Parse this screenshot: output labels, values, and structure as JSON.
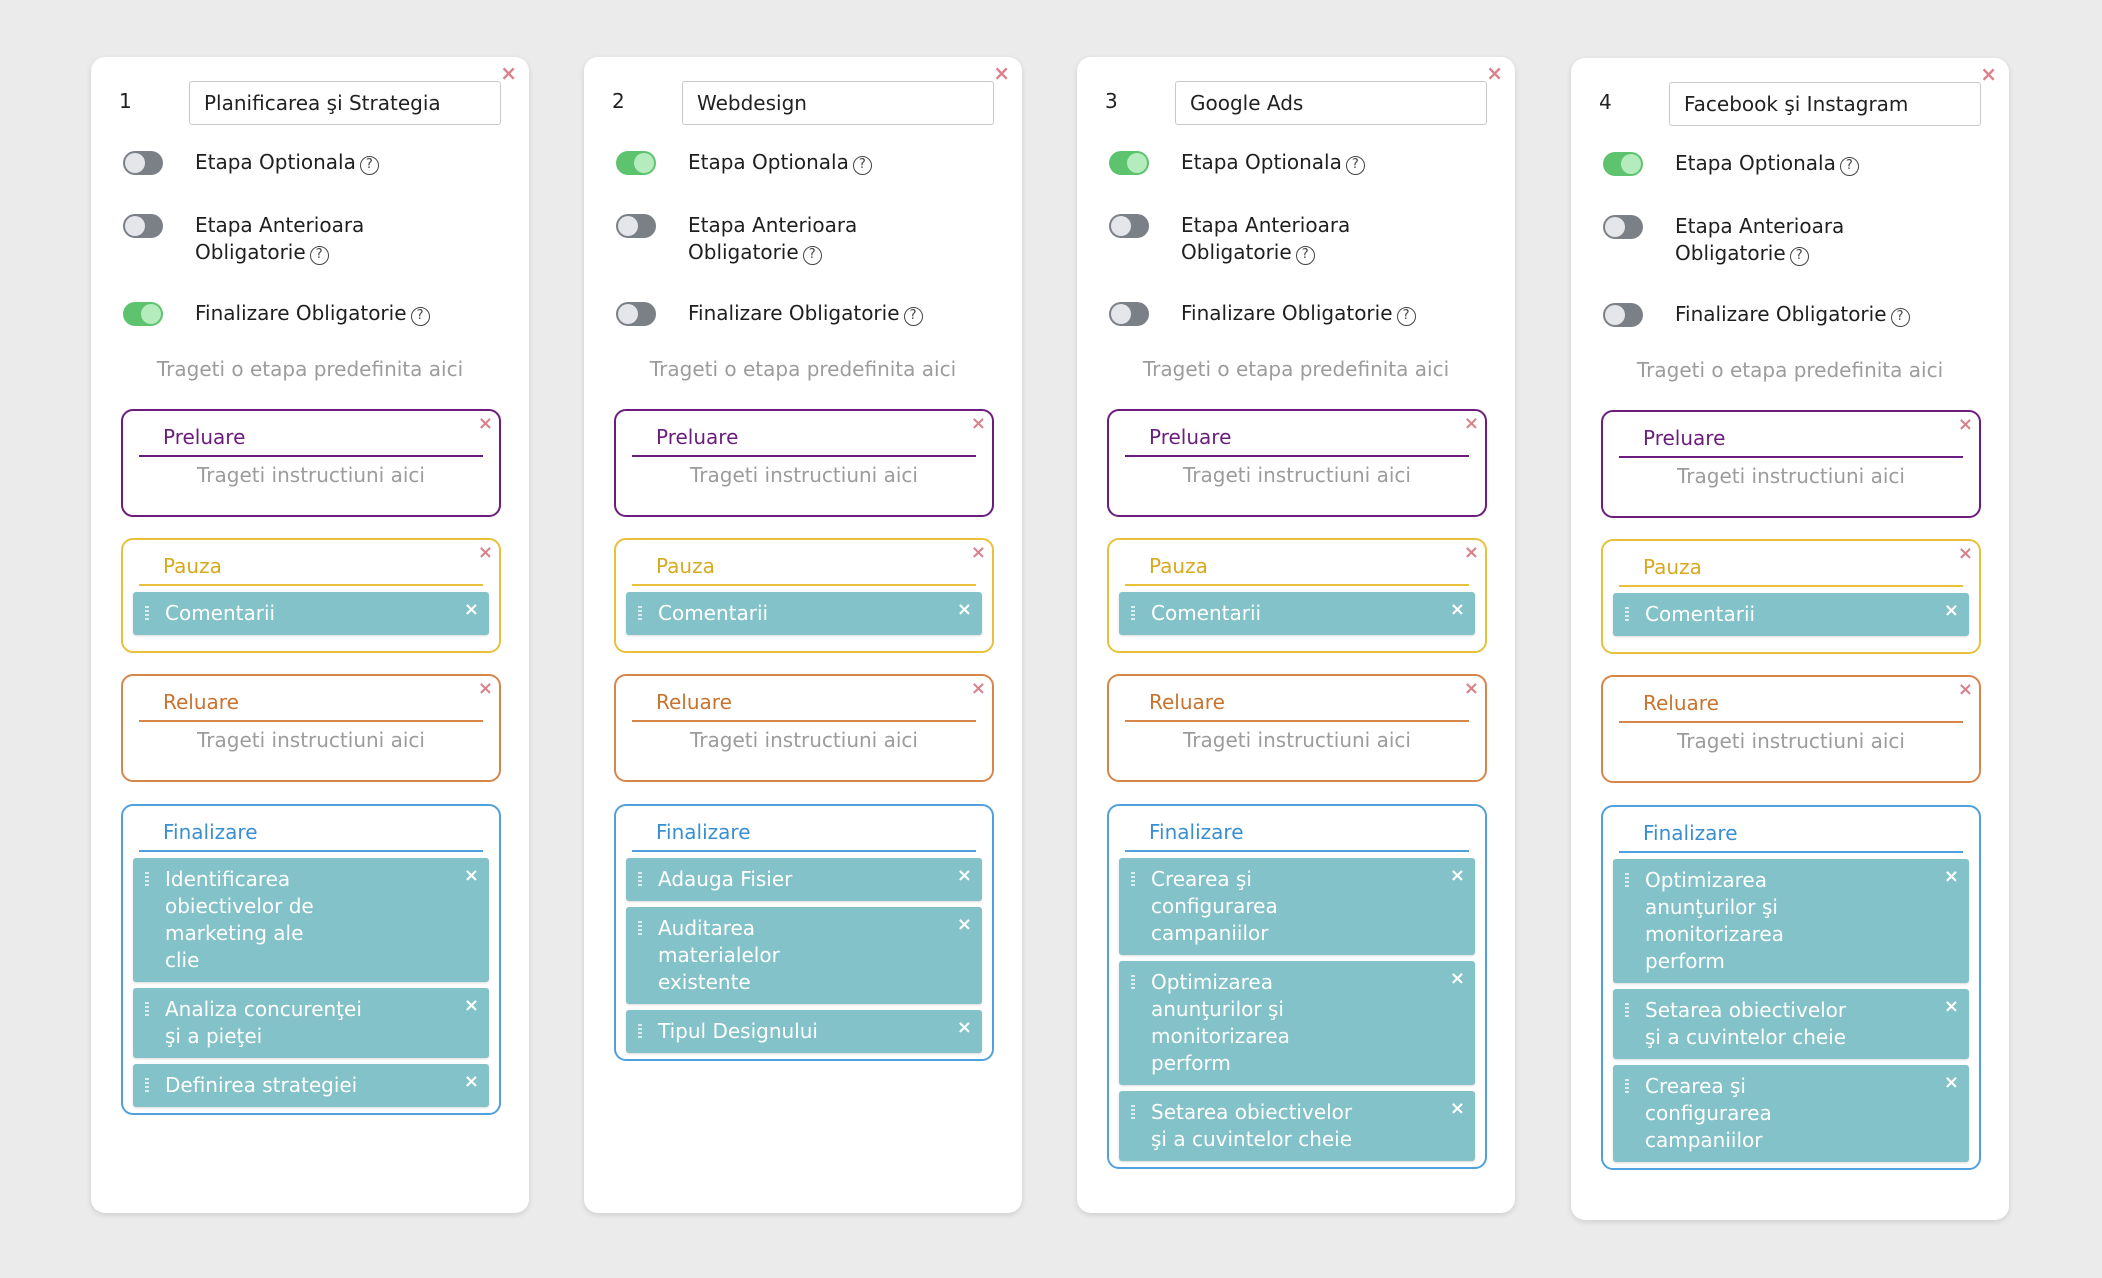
{
  "columns": [
    {
      "number": "1",
      "name": "Planificarea şi Strategia",
      "optional_label": "Etapa Optionala",
      "previous_required_label": "Etapa Anterioara Obligatorie",
      "final_required_label": "Finalizare Obligatorie",
      "optional_on": false,
      "previous_on": false,
      "final_on": true,
      "drop_hint": "Trageti o etapa predefinita aici",
      "preluare": {
        "title": "Preluare",
        "hint": "Trageti instructiuni aici"
      },
      "pauza": {
        "title": "Pauza",
        "items": [
          "Comentarii"
        ]
      },
      "reluare": {
        "title": "Reluare",
        "hint": "Trageti instructiuni aici"
      },
      "finalizare": {
        "title": "Finalizare",
        "items": [
          "Identificarea obiectivelor de marketing ale clie",
          "Analiza concurenţei şi a pieţei",
          "Definirea strategiei"
        ]
      }
    },
    {
      "number": "2",
      "name": "Webdesign",
      "optional_label": "Etapa Optionala",
      "previous_required_label": "Etapa Anterioara Obligatorie",
      "final_required_label": "Finalizare Obligatorie",
      "optional_on": true,
      "previous_on": false,
      "final_on": false,
      "drop_hint": "Trageti o etapa predefinita aici",
      "preluare": {
        "title": "Preluare",
        "hint": "Trageti instructiuni aici"
      },
      "pauza": {
        "title": "Pauza",
        "items": [
          "Comentarii"
        ]
      },
      "reluare": {
        "title": "Reluare",
        "hint": "Trageti instructiuni aici"
      },
      "finalizare": {
        "title": "Finalizare",
        "items": [
          "Adauga Fisier",
          "Auditarea materialelor existente",
          "Tipul Designului"
        ]
      }
    },
    {
      "number": "3",
      "name": "Google Ads",
      "optional_label": "Etapa Optionala",
      "previous_required_label": "Etapa Anterioara Obligatorie",
      "final_required_label": "Finalizare Obligatorie",
      "optional_on": true,
      "previous_on": false,
      "final_on": false,
      "drop_hint": "Trageti o etapa predefinita aici",
      "preluare": {
        "title": "Preluare",
        "hint": "Trageti instructiuni aici"
      },
      "pauza": {
        "title": "Pauza",
        "items": [
          "Comentarii"
        ]
      },
      "reluare": {
        "title": "Reluare",
        "hint": "Trageti instructiuni aici"
      },
      "finalizare": {
        "title": "Finalizare",
        "items": [
          "Crearea şi configurarea campaniilor",
          "Optimizarea anunţurilor şi monitorizarea perform",
          "Setarea obiectivelor şi a cuvintelor cheie"
        ]
      }
    },
    {
      "number": "4",
      "name": "Facebook şi Instagram",
      "optional_label": "Etapa Optionala",
      "previous_required_label": "Etapa Anterioara Obligatorie",
      "final_required_label": "Finalizare Obligatorie",
      "optional_on": true,
      "previous_on": false,
      "final_on": false,
      "drop_hint": "Trageti o etapa predefinita aici",
      "preluare": {
        "title": "Preluare",
        "hint": "Trageti instructiuni aici"
      },
      "pauza": {
        "title": "Pauza",
        "items": [
          "Comentarii"
        ]
      },
      "reluare": {
        "title": "Reluare",
        "hint": "Trageti instructiuni aici"
      },
      "finalizare": {
        "title": "Finalizare",
        "items": [
          "Optimizarea anunţurilor şi monitorizarea perform",
          "Setarea obiectivelor şi a cuvintelor cheie",
          "Crearea şi configurarea campaniilor"
        ]
      }
    }
  ],
  "icons": {
    "close": "close-icon",
    "help": "help-circle-icon",
    "drag": "drag-handle-icon"
  },
  "colors": {
    "background": "#ebebeb",
    "toggle_on": "#5ec36e",
    "toggle_off": "#7b7f86",
    "preluare": "#6b1d7d",
    "pauza": "#e9c03a",
    "reluare": "#d7864a",
    "finalizare": "#4fa0dd",
    "item_bg": "#82c2c8",
    "close": "#d9828c"
  }
}
